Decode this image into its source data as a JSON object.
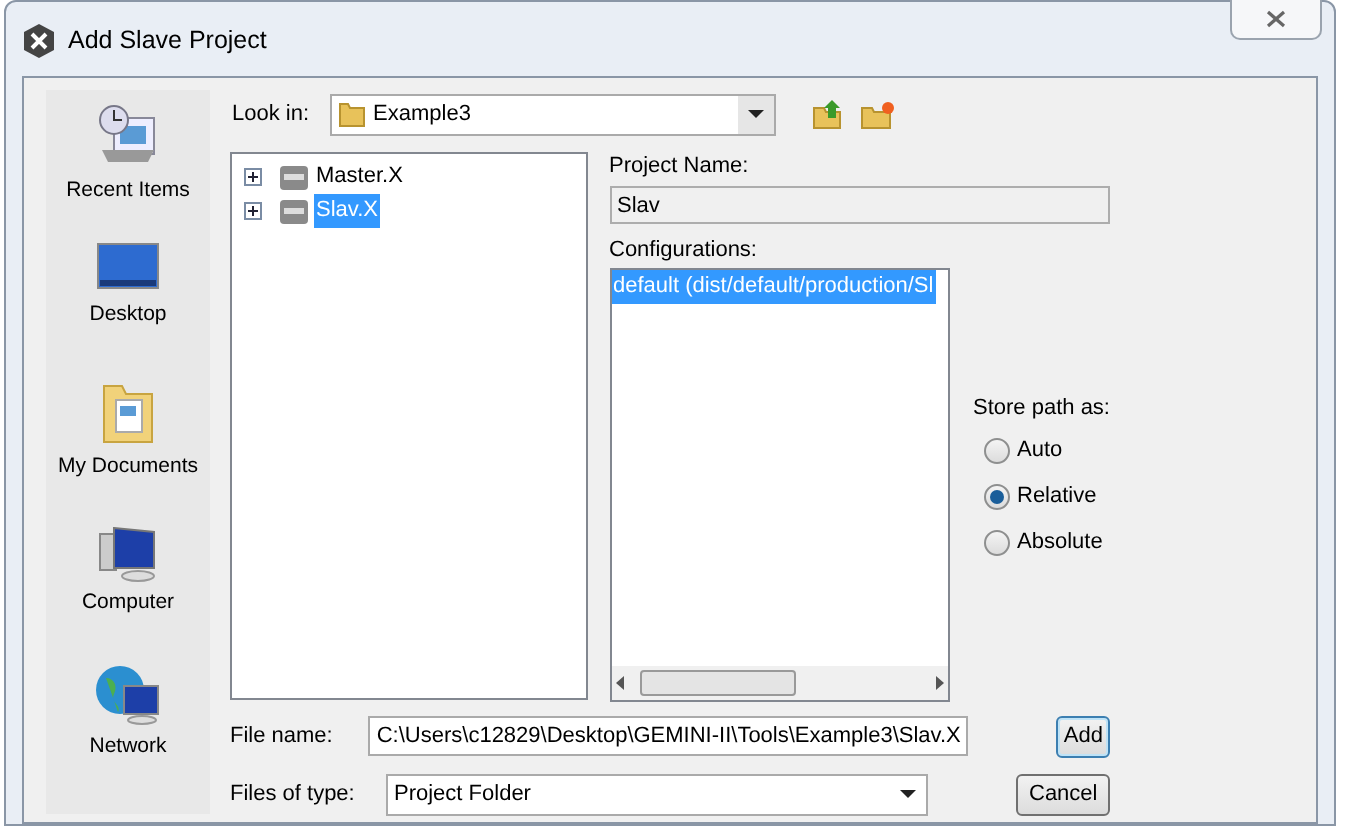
{
  "window": {
    "title": "Add Slave Project"
  },
  "sidebar": {
    "items": [
      {
        "label": "Recent Items",
        "kind": "recent"
      },
      {
        "label": "Desktop",
        "kind": "desktop"
      },
      {
        "label": "My Documents",
        "kind": "documents"
      },
      {
        "label": "Computer",
        "kind": "computer"
      },
      {
        "label": "Network",
        "kind": "network"
      }
    ]
  },
  "look_in": {
    "label": "Look in:",
    "value": "Example3"
  },
  "tree": [
    {
      "label": "Master.X",
      "selected": false,
      "expanded": false
    },
    {
      "label": "Slav.X",
      "selected": true,
      "expanded": false
    }
  ],
  "project_name": {
    "label": "Project Name:",
    "value": "Slav"
  },
  "configurations": {
    "label": "Configurations:",
    "items": [
      {
        "label": "default (dist/default/production/Sl",
        "selected": true
      }
    ]
  },
  "store_path": {
    "label": "Store path as:",
    "options": [
      {
        "label": "Auto",
        "selected": false
      },
      {
        "label": "Relative",
        "selected": true
      },
      {
        "label": "Absolute",
        "selected": false
      }
    ]
  },
  "file_name": {
    "label": "File name:",
    "value": "C:\\Users\\c12829\\Desktop\\GEMINI-II\\Tools\\Example3\\Slav.X"
  },
  "files_of_type": {
    "label": "Files of type:",
    "value": "Project Folder"
  },
  "buttons": [
    {
      "label": "Add",
      "default": true
    },
    {
      "label": "Cancel",
      "default": false
    }
  ]
}
